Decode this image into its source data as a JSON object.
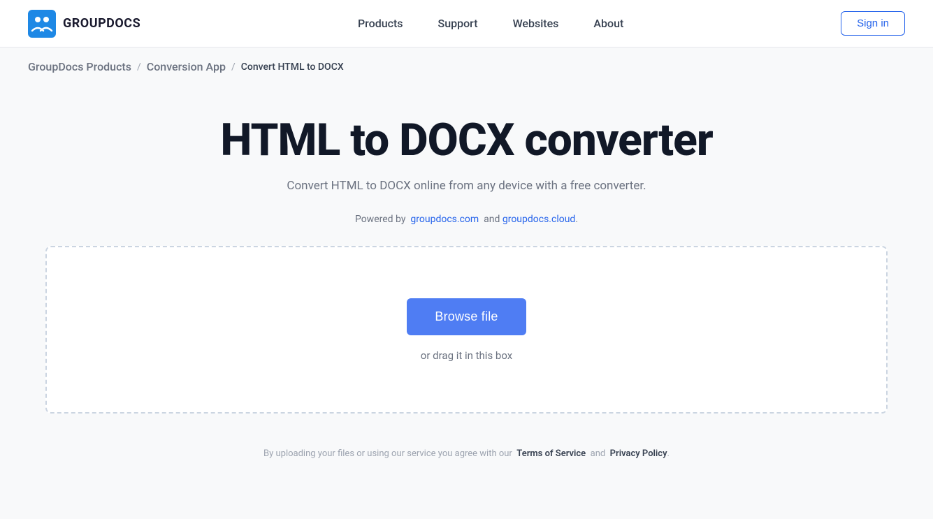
{
  "header": {
    "logo_text": "GROUPDOCS",
    "nav_items": [
      {
        "label": "Products",
        "href": "#"
      },
      {
        "label": "Support",
        "href": "#"
      },
      {
        "label": "Websites",
        "href": "#"
      },
      {
        "label": "About",
        "href": "#"
      }
    ],
    "sign_in_label": "Sign in"
  },
  "breadcrumb": {
    "items": [
      {
        "label": "GroupDocs Products",
        "href": "#"
      },
      {
        "label": "Conversion App",
        "href": "#"
      },
      {
        "label": "Convert HTML to DOCX",
        "href": null
      }
    ]
  },
  "main": {
    "page_title": "HTML to DOCX converter",
    "subtitle": "Convert HTML to DOCX online from any device with a free converter.",
    "powered_by_text": "Powered by",
    "powered_by_link1_label": "groupdocs.com",
    "powered_by_link1_href": "#",
    "powered_by_and": "and",
    "powered_by_link2_label": "groupdocs.cloud",
    "powered_by_link2_href": "#",
    "powered_by_period": ".",
    "browse_btn_label": "Browse file",
    "drag_text": "or drag it in this box"
  },
  "footer": {
    "note_prefix": "By uploading your files or using our service you agree with our",
    "tos_label": "Terms of Service",
    "tos_href": "#",
    "note_and": "and",
    "privacy_label": "Privacy Policy",
    "privacy_href": "#",
    "note_suffix": "."
  },
  "icons": {
    "logo": "groupdocs-logo"
  }
}
